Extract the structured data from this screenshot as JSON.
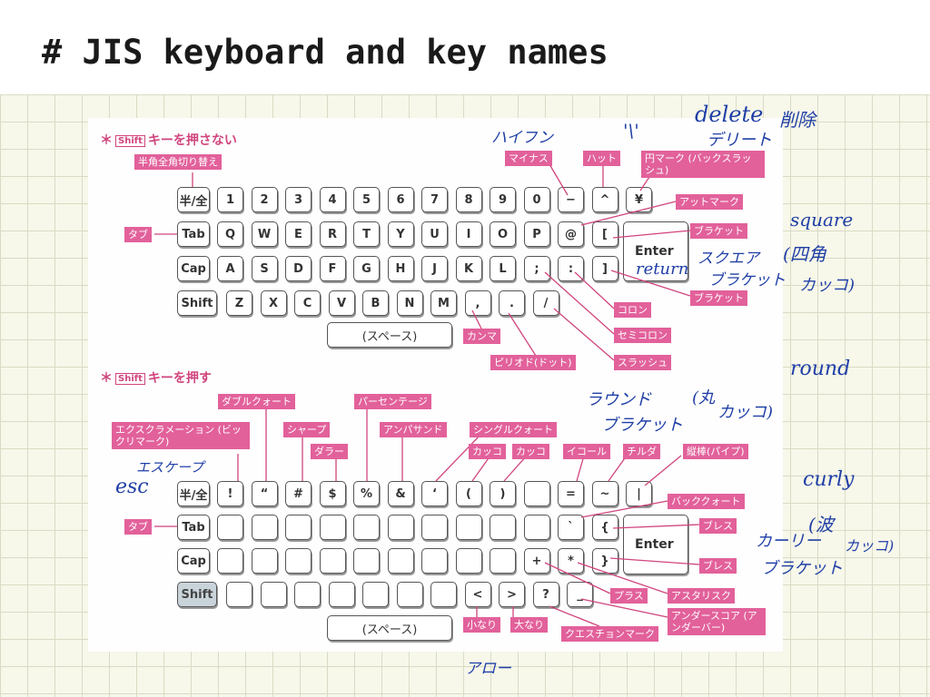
{
  "title": "# JIS keyboard and key names",
  "sections": {
    "no_shift": "キーを押さない",
    "shift": "キーを押す",
    "shift_badge": "Shift",
    "star": "＊"
  },
  "keys": {
    "hankaku": "半/全",
    "tab": "Tab",
    "cap": "Cap",
    "shift": "Shift",
    "enter": "Enter",
    "space": "(スペース)",
    "row1": [
      "1",
      "2",
      "3",
      "4",
      "5",
      "6",
      "7",
      "8",
      "9",
      "0",
      "−",
      "^",
      "¥"
    ],
    "row2": [
      "Q",
      "W",
      "E",
      "R",
      "T",
      "Y",
      "U",
      "I",
      "O",
      "P",
      "@",
      "["
    ],
    "row3": [
      "A",
      "S",
      "D",
      "F",
      "G",
      "H",
      "J",
      "K",
      "L",
      ";",
      ":",
      "]"
    ],
    "row4": [
      "Z",
      "X",
      "C",
      "V",
      "B",
      "N",
      "M",
      ",",
      ".",
      "/"
    ],
    "s_row1": [
      "!",
      "“",
      "#",
      "$",
      "%",
      "&",
      "‘",
      "(",
      ")",
      "",
      "=",
      "~",
      "|"
    ],
    "s_row2": [
      "",
      "",
      "",
      "",
      "",
      "",
      "",
      "",
      "",
      "",
      "`",
      "{"
    ],
    "s_row3": [
      "",
      "",
      "",
      "",
      "",
      "",
      "",
      "",
      "",
      "+",
      "*",
      "}"
    ],
    "s_row4": [
      "",
      "",
      "",
      "",
      "",
      "",
      "",
      "<",
      ">",
      "?",
      "_"
    ]
  },
  "labels": {
    "hankaku_switch": "半角全角切り替え",
    "tab": "タブ",
    "minus": "マイナス",
    "hat": "ハット",
    "yen": "円マーク (バックスラッシュ)",
    "atmark": "アットマーク",
    "bracket_open": "ブラケット",
    "bracket_close": "ブラケット",
    "colon": "コロン",
    "semicolon": "セミコロン",
    "comma": "カンマ",
    "slash": "スラッシュ",
    "period": "ピリオド(ドット)",
    "exclamation": "エクスクラメーション (ビックリマーク)",
    "double_quote": "ダブルクォート",
    "sharp": "シャープ",
    "dollar": "ダラー",
    "percent": "パーセンテージ",
    "ampersand": "アンパサンド",
    "single_quote": "シングルクォート",
    "paren_open": "カッコ",
    "paren_close": "カッコ",
    "equal": "イコール",
    "tilde": "チルダ",
    "pipe": "縦棒(パイプ)",
    "backquote": "バッククォート",
    "brace_open": "ブレス",
    "brace_close": "ブレス",
    "plus": "プラス",
    "asterisk": "アスタリスク",
    "underscore": "アンダースコア (アンダーバー)",
    "less": "小なり",
    "greater": "大なり",
    "question": "クエスチョンマーク",
    "tab2": "タブ"
  },
  "handwriting": {
    "hyphen": "ハイフン",
    "quote_mark": "'\\'",
    "delete": "delete",
    "sakujo": "削除",
    "delete_kana": "デリート",
    "square": "square",
    "shikaku": "(四角",
    "kakko1": "カッコ)",
    "square_bracket": "スクエア",
    "return": "return",
    "bracket_kana": "ブラケット",
    "round": "round",
    "round_kana": "ラウンド",
    "maru": "(丸",
    "kakko2": "カッコ)",
    "round_bracket": "ブラケット",
    "escape_kana": "エスケープ",
    "esc": "esc",
    "curly": "curly",
    "curly_kana": "カーリー",
    "nami": "(波",
    "kakko3": "カッコ)",
    "curly_bracket": "ブラケット",
    "arrow": "アロー"
  }
}
